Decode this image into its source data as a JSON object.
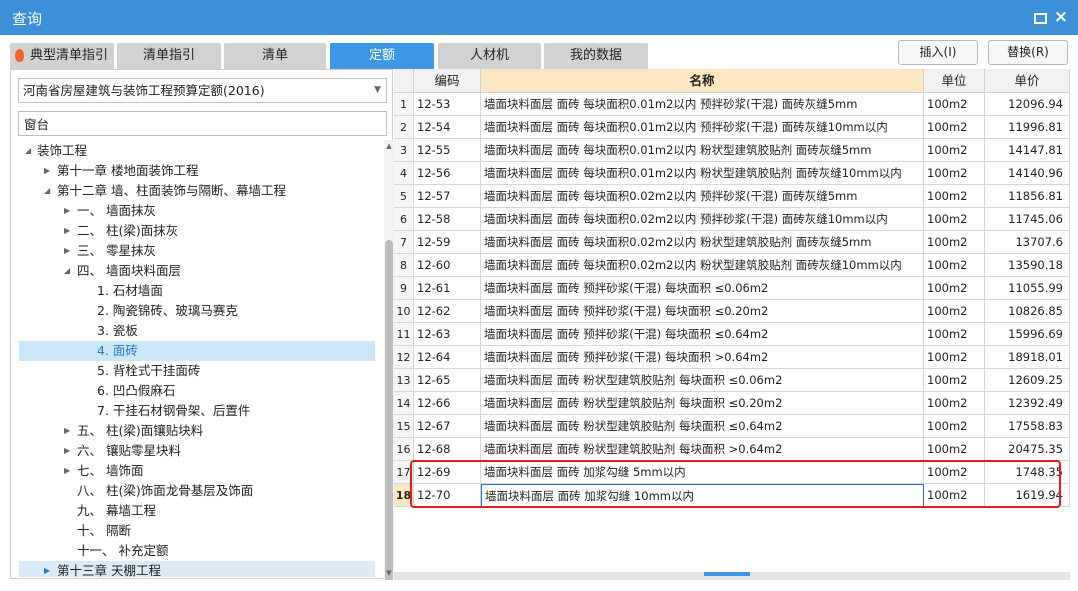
{
  "window": {
    "title": "查询"
  },
  "tabs": [
    {
      "label": "典型清单指引",
      "active": false
    },
    {
      "label": "清单指引",
      "active": false
    },
    {
      "label": "清单",
      "active": false
    },
    {
      "label": "定额",
      "active": true
    },
    {
      "label": "人材机",
      "active": false
    },
    {
      "label": "我的数据",
      "active": false
    }
  ],
  "actions": {
    "insert": "插入(I)",
    "replace": "替换(R)"
  },
  "left": {
    "library": "河南省房屋建筑与装饰工程预算定额(2016)",
    "search_value": "窗台"
  },
  "tree": [
    {
      "label": "装饰工程",
      "level": 0,
      "toggle": "open"
    },
    {
      "label": "第十一章 楼地面装饰工程",
      "level": 1,
      "toggle": "closed"
    },
    {
      "label": "第十二章 墙、柱面装饰与隔断、幕墙工程",
      "level": 1,
      "toggle": "open"
    },
    {
      "label": "一、 墙面抹灰",
      "level": 2,
      "toggle": "closed"
    },
    {
      "label": "二、 柱(梁)面抹灰",
      "level": 2,
      "toggle": "closed"
    },
    {
      "label": "三、 零星抹灰",
      "level": 2,
      "toggle": "closed"
    },
    {
      "label": "四、 墙面块料面层",
      "level": 2,
      "toggle": "open"
    },
    {
      "label": "1. 石材墙面",
      "level": 3,
      "toggle": ""
    },
    {
      "label": "2. 陶瓷锦砖、玻璃马赛克",
      "level": 3,
      "toggle": ""
    },
    {
      "label": "3. 瓷板",
      "level": 3,
      "toggle": ""
    },
    {
      "label": "4. 面砖",
      "level": 3,
      "toggle": "",
      "selected": true
    },
    {
      "label": "5. 背栓式干挂面砖",
      "level": 3,
      "toggle": ""
    },
    {
      "label": "6. 凹凸假麻石",
      "level": 3,
      "toggle": ""
    },
    {
      "label": "7. 干挂石材钢骨架、后置件",
      "level": 3,
      "toggle": ""
    },
    {
      "label": "五、 柱(梁)面镶贴块料",
      "level": 2,
      "toggle": "closed"
    },
    {
      "label": "六、 镶贴零星块料",
      "level": 2,
      "toggle": "closed"
    },
    {
      "label": "七、 墙饰面",
      "level": 2,
      "toggle": "closed"
    },
    {
      "label": "八、 柱(梁)饰面龙骨基层及饰面",
      "level": 2,
      "toggle": ""
    },
    {
      "label": "九、 幕墙工程",
      "level": 2,
      "toggle": ""
    },
    {
      "label": "十、 隔断",
      "level": 2,
      "toggle": ""
    },
    {
      "label": "十一、 补充定额",
      "level": 2,
      "toggle": ""
    },
    {
      "label": "第十三章 天棚工程",
      "level": 1,
      "toggle": "closed",
      "hover": true
    }
  ],
  "grid": {
    "headers": [
      "",
      "编码",
      "名称",
      "单位",
      "单价"
    ],
    "rows": [
      {
        "no": "1",
        "code": "12-53",
        "name": "墙面块料面层 面砖 每块面积0.01m2以内 预拌砂浆(干混) 面砖灰缝5mm",
        "unit": "100m2",
        "price": "12096.94"
      },
      {
        "no": "2",
        "code": "12-54",
        "name": "墙面块料面层 面砖 每块面积0.01m2以内 预拌砂浆(干混) 面砖灰缝10mm以内",
        "unit": "100m2",
        "price": "11996.81"
      },
      {
        "no": "3",
        "code": "12-55",
        "name": "墙面块料面层 面砖 每块面积0.01m2以内 粉状型建筑胶贴剂 面砖灰缝5mm",
        "unit": "100m2",
        "price": "14147.81"
      },
      {
        "no": "4",
        "code": "12-56",
        "name": "墙面块料面层 面砖 每块面积0.01m2以内 粉状型建筑胶贴剂 面砖灰缝10mm以内",
        "unit": "100m2",
        "price": "14140.96"
      },
      {
        "no": "5",
        "code": "12-57",
        "name": "墙面块料面层 面砖 每块面积0.02m2以内 预拌砂浆(干混) 面砖灰缝5mm",
        "unit": "100m2",
        "price": "11856.81"
      },
      {
        "no": "6",
        "code": "12-58",
        "name": "墙面块料面层 面砖 每块面积0.02m2以内 预拌砂浆(干混) 面砖灰缝10mm以内",
        "unit": "100m2",
        "price": "11745.06"
      },
      {
        "no": "7",
        "code": "12-59",
        "name": "墙面块料面层 面砖 每块面积0.02m2以内 粉状型建筑胶贴剂 面砖灰缝5mm",
        "unit": "100m2",
        "price": "13707.6"
      },
      {
        "no": "8",
        "code": "12-60",
        "name": "墙面块料面层 面砖 每块面积0.02m2以内 粉状型建筑胶贴剂 面砖灰缝10mm以内",
        "unit": "100m2",
        "price": "13590.18"
      },
      {
        "no": "9",
        "code": "12-61",
        "name": "墙面块料面层 面砖 预拌砂浆(干混) 每块面积 ≤0.06m2",
        "unit": "100m2",
        "price": "11055.99"
      },
      {
        "no": "10",
        "code": "12-62",
        "name": "墙面块料面层 面砖 预拌砂浆(干混) 每块面积 ≤0.20m2",
        "unit": "100m2",
        "price": "10826.85"
      },
      {
        "no": "11",
        "code": "12-63",
        "name": "墙面块料面层 面砖 预拌砂浆(干混) 每块面积 ≤0.64m2",
        "unit": "100m2",
        "price": "15996.69"
      },
      {
        "no": "12",
        "code": "12-64",
        "name": "墙面块料面层 面砖 预拌砂浆(干混) 每块面积 >0.64m2",
        "unit": "100m2",
        "price": "18918.01"
      },
      {
        "no": "13",
        "code": "12-65",
        "name": "墙面块料面层 面砖 粉状型建筑胶贴剂 每块面积 ≤0.06m2",
        "unit": "100m2",
        "price": "12609.25"
      },
      {
        "no": "14",
        "code": "12-66",
        "name": "墙面块料面层 面砖 粉状型建筑胶贴剂 每块面积 ≤0.20m2",
        "unit": "100m2",
        "price": "12392.49"
      },
      {
        "no": "15",
        "code": "12-67",
        "name": "墙面块料面层 面砖 粉状型建筑胶贴剂 每块面积 ≤0.64m2",
        "unit": "100m2",
        "price": "17558.83"
      },
      {
        "no": "16",
        "code": "12-68",
        "name": "墙面块料面层 面砖 粉状型建筑胶贴剂 每块面积 >0.64m2",
        "unit": "100m2",
        "price": "20475.35"
      },
      {
        "no": "17",
        "code": "12-69",
        "name": "墙面块料面层 面砖 加浆勾缝 5mm以内",
        "unit": "100m2",
        "price": "1748.35"
      },
      {
        "no": "18",
        "code": "12-70",
        "name": "墙面块料面层 面砖 加浆勾缝 10mm以内",
        "unit": "100m2",
        "price": "1619.94",
        "current": true
      }
    ]
  },
  "colors": {
    "titlebar": "#3d8fd8",
    "active_tab": "#3d96e6",
    "selection": "#cde6f8",
    "highlight_box": "#e11d1d"
  }
}
